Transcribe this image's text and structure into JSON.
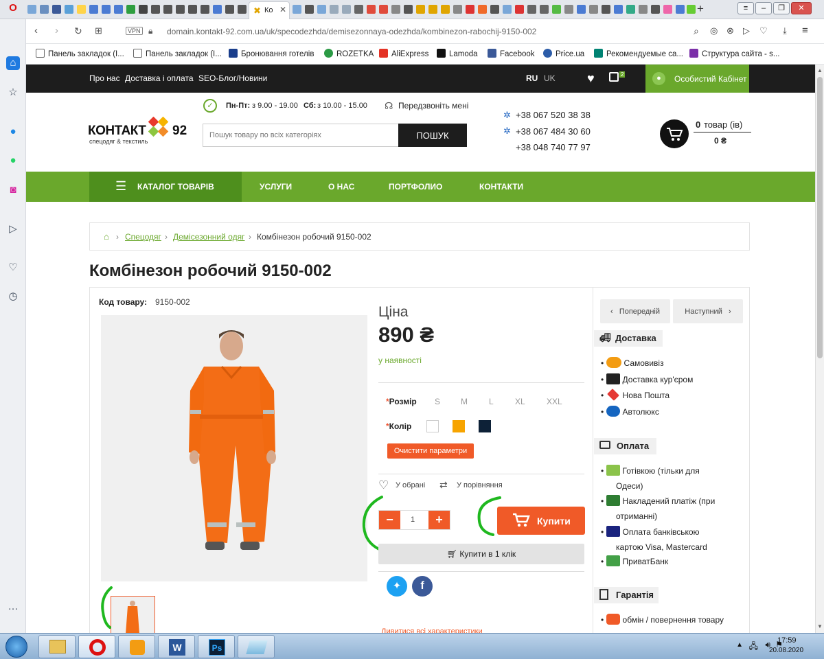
{
  "browser": {
    "active_tab_title": "Ко",
    "url": "domain.kontakt-92.com.ua/uk/specodezhda/demisezonnaya-odezhda/kombinezon-rabochij-9150-002",
    "vpn_label": "VPN",
    "bookmarks": [
      {
        "label": "Панель закладок (І...",
        "icon": "folder-icon"
      },
      {
        "label": "Панель закладок (І...",
        "icon": "folder-icon"
      },
      {
        "label": "Бронювання готелів",
        "icon": "booking-icon"
      },
      {
        "label": "ROZETKA",
        "icon": "rozetka-icon"
      },
      {
        "label": "AliExpress",
        "icon": "aliexpress-icon"
      },
      {
        "label": "Lamoda",
        "icon": "lamoda-icon"
      },
      {
        "label": "Facebook",
        "icon": "facebook-icon"
      },
      {
        "label": "Price.ua",
        "icon": "priceua-icon"
      },
      {
        "label": "Рекомендуемые са...",
        "icon": "bing-icon"
      },
      {
        "label": "Структура сайта - s...",
        "icon": "cart-icon"
      }
    ]
  },
  "site": {
    "topbar": {
      "links": [
        "Про нас",
        "Доставка і оплата",
        "SEO-Блог/Новини"
      ],
      "lang_ru": "RU",
      "lang_uk": "UK",
      "compare_count": "2",
      "cabinet_label": "Особистий Кабінет"
    },
    "header": {
      "logo_main": "КОНТАКТ",
      "logo_num": "92",
      "logo_sub": "спецодяг & текстиль",
      "hours_weekday_label": "Пн-Пт:",
      "hours_weekday": "з 9.00 - 19.00",
      "hours_sat_label": "Сб:",
      "hours_sat": "з 10.00 - 15.00",
      "callback": "Передзвоніть мені",
      "search_placeholder": "Пошук товару по всіх категоріях",
      "search_button": "ПОШУК",
      "phones": [
        "+38 067 520 38 38",
        "+38 067 484 30 60",
        "+38 048 740 77 97"
      ],
      "cart_count": "0",
      "cart_label": "товар (ів)",
      "cart_total": "0 ₴"
    },
    "nav": {
      "catalog": "КАТАЛОГ ТОВАРІВ",
      "items": [
        "УСЛУГИ",
        "О НАС",
        "ПОРТФОЛИО",
        "КОНТАКТИ"
      ]
    },
    "breadcrumb": {
      "items": [
        "Спецодяг",
        "Демісезонний одяг"
      ],
      "current": "Комбінезон робочий 9150-002"
    },
    "product": {
      "title": "Комбінезон робочий 9150-002",
      "code_label": "Код товару:",
      "code": "9150-002",
      "price_label": "Ціна",
      "price": "890 ₴",
      "stock": "у наявності",
      "size_label": "Розмір",
      "sizes": [
        "S",
        "M",
        "L",
        "XL",
        "XXL"
      ],
      "color_label": "Колір",
      "colors": [
        "#ffffff",
        "#f7a400",
        "#0d2137"
      ],
      "clear_button": "Очистити параметри",
      "wishlist": "У обрані",
      "compare": "У порівняння",
      "quantity": "1",
      "buy_button": "Купити",
      "oneclick_button": "Купити в 1 клік",
      "characteristics_link": "Дивитися всі характеристики"
    },
    "sidebar": {
      "prev": "Попередній",
      "next": "Наступний",
      "delivery_title": "Доставка",
      "delivery_items": [
        "Самовивіз",
        "Доставка кур'єром",
        "Нова Пошта",
        "Автолюкс"
      ],
      "payment_title": "Оплата",
      "payment_items": [
        "Готівкою (тільки для",
        "Одеси)",
        "Накладений платіж (при",
        "отриманні)",
        "Оплата банківською",
        "картою Visa, Mastercard",
        "ПриватБанк"
      ],
      "guarantee_title": "Гарантія",
      "guarantee_items": [
        "обмін / повернення товару"
      ]
    }
  },
  "taskbar": {
    "time": "17:59",
    "date": "20.08.2020"
  },
  "colors": {
    "brand_green": "#6aa82c",
    "dark_green": "#4e8f1d",
    "buy_orange": "#f05a28",
    "topbar_dark": "#1d1d1d"
  }
}
